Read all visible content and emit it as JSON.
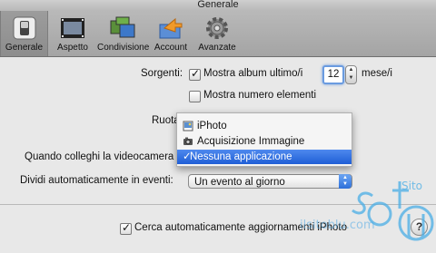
{
  "window": {
    "title": "Generale"
  },
  "toolbar": {
    "items": [
      {
        "label": "Generale",
        "icon": "switch-icon",
        "selected": true
      },
      {
        "label": "Aspetto",
        "icon": "film-icon"
      },
      {
        "label": "Condivisione",
        "icon": "share-icon"
      },
      {
        "label": "Account",
        "icon": "arrow-box-icon"
      },
      {
        "label": "Avanzate",
        "icon": "gear-icon"
      }
    ]
  },
  "sources": {
    "label": "Sorgenti:",
    "show_last_album": {
      "label": "Mostra album ultimo/i",
      "checked": true
    },
    "months_value": "12",
    "months_unit": "mese/i",
    "show_item_count": {
      "label": "Mostra numero elementi",
      "checked": false
    }
  },
  "rotate": {
    "label": "Ruota"
  },
  "camera": {
    "label": "Quando colleghi la videocamera"
  },
  "popup_menu": {
    "items": [
      {
        "label": "iPhoto",
        "icon": "iphoto-icon",
        "selected": false
      },
      {
        "label": "Acquisizione Immagine",
        "icon": "image-capture-icon",
        "selected": false
      },
      {
        "label": "Nessuna applicazione",
        "check": "✓",
        "selected": true
      }
    ]
  },
  "events": {
    "label": "Dividi automaticamente in eventi:",
    "value": "Un evento al giorno"
  },
  "updates": {
    "label": "Cerca automaticamente aggiornamenti iPhoto",
    "checked": true
  },
  "help": {
    "label": "?"
  },
  "watermark": {
    "text": "ilsitoblu.com",
    "logo_text": "Sito"
  },
  "colors": {
    "accent": "#2d6fd8",
    "watermark": "#4aaee6"
  }
}
